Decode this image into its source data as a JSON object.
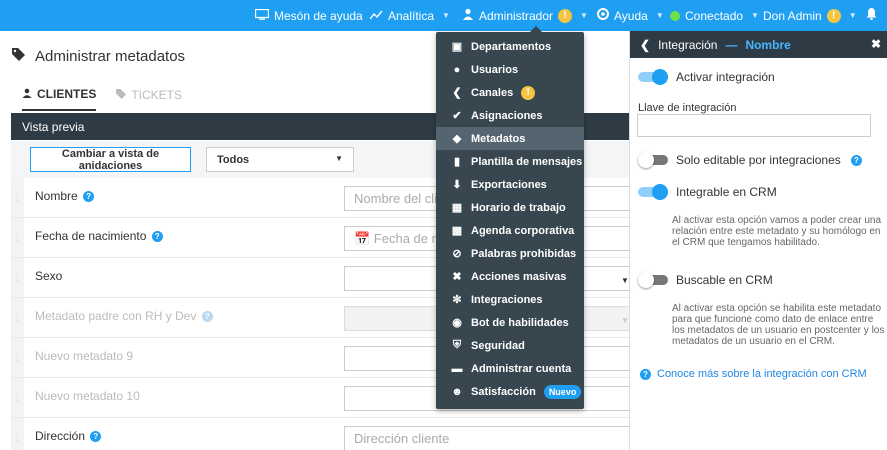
{
  "topbar": {
    "helpdesk": "Mesón de ayuda",
    "analytics": "Analítica",
    "admin": "Administrador",
    "admin_badge": "!",
    "help": "Ayuda",
    "status": "Conectado",
    "user": "Don Admin",
    "user_badge": "!"
  },
  "page": {
    "title": "Administrar metadatos",
    "tabs": [
      {
        "label": "CLIENTES",
        "active": true
      },
      {
        "label": "TICKETS",
        "active": false
      }
    ],
    "preview_label": "Vista previa",
    "toggle_button": "Cambiar a vista de anidaciones",
    "filter_value": "Todos"
  },
  "rows": [
    {
      "label": "Nombre",
      "placeholder": "Nombre del cli",
      "type": "text",
      "help": true,
      "muted": false
    },
    {
      "label": "Fecha de nacimiento",
      "placeholder": "📅 Fecha de nac",
      "type": "text",
      "help": true,
      "muted": false
    },
    {
      "label": "Sexo",
      "placeholder": "",
      "type": "select",
      "help": false,
      "muted": false
    },
    {
      "label": "Metadato padre con RH y Dev",
      "placeholder": "",
      "type": "select-disabled",
      "help": true,
      "muted": true
    },
    {
      "label": "Nuevo metadato 9",
      "placeholder": "",
      "type": "text",
      "help": false,
      "muted": true
    },
    {
      "label": "Nuevo metadato 10",
      "placeholder": "",
      "type": "text",
      "help": false,
      "muted": true
    },
    {
      "label": "Dirección",
      "placeholder": "Dirección cliente",
      "type": "text",
      "help": true,
      "muted": false
    }
  ],
  "menu": {
    "items": [
      {
        "label": "Departamentos",
        "icon": "briefcase-icon"
      },
      {
        "label": "Usuarios",
        "icon": "users-icon"
      },
      {
        "label": "Canales",
        "icon": "share-icon",
        "badge": "!"
      },
      {
        "label": "Asignaciones",
        "icon": "check-circle-icon"
      },
      {
        "label": "Metadatos",
        "icon": "tag-icon",
        "active": true
      },
      {
        "label": "Plantilla de mensajes",
        "icon": "book-icon"
      },
      {
        "label": "Exportaciones",
        "icon": "download-icon"
      },
      {
        "label": "Horario de trabajo",
        "icon": "calendar-icon"
      },
      {
        "label": "Agenda corporativa",
        "icon": "address-card-icon"
      },
      {
        "label": "Palabras prohibidas",
        "icon": "ban-icon"
      },
      {
        "label": "Acciones masivas",
        "icon": "wrench-icon"
      },
      {
        "label": "Integraciones",
        "icon": "puzzle-icon"
      },
      {
        "label": "Bot de habilidades",
        "icon": "robot-icon"
      },
      {
        "label": "Seguridad",
        "icon": "shield-icon"
      },
      {
        "label": "Administrar cuenta",
        "icon": "card-icon"
      },
      {
        "label": "Satisfacción",
        "icon": "smile-icon",
        "badge_text": "Nuevo"
      }
    ]
  },
  "panel": {
    "header_prefix": "Integración",
    "header_name": "Nombre",
    "activate_label": "Activar integración",
    "key_label": "Llave de integración",
    "key_value": "",
    "only_editable_label": "Solo editable por integraciones",
    "crm_label": "Integrable en CRM",
    "crm_desc": "Al activar esta opción vamos a poder crear una relación entre este metadato y su homólogo en el CRM que tengamos habilitado.",
    "searchable_label": "Buscable en CRM",
    "searchable_desc": "Al activar esta opción se habilita este metadato para que funcione como dato de enlace entre los metadatos de un usuario en postcenter y los metadatos de un usuario en el CRM.",
    "link": "Conoce más sobre la integración con CRM",
    "switches": {
      "activate": true,
      "only_editable": false,
      "crm": true,
      "searchable": false
    }
  },
  "colors": {
    "accent": "#1e9ff2",
    "dark": "#2f3b44",
    "menu": "#37464f"
  }
}
